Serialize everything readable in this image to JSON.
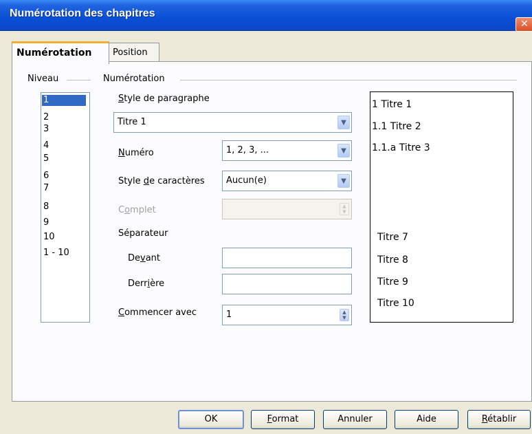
{
  "window": {
    "title": "Numérotation des chapitres",
    "close_glyph": "✕"
  },
  "tabs": [
    {
      "label": "Numérotation",
      "active": true
    },
    {
      "label": "Position",
      "active": false
    }
  ],
  "levels": {
    "label": "Niveau",
    "items": [
      "1",
      "2",
      "3",
      "4",
      "5",
      "6",
      "7",
      "8",
      "9",
      "10",
      "1 - 10"
    ],
    "selected": "1"
  },
  "numbering": {
    "group_label": "Numérotation",
    "paragraph_style": {
      "label_pre": "",
      "label_u": "S",
      "label_post": "tyle de paragraphe",
      "value": "Titre 1"
    },
    "number": {
      "label_pre": "",
      "label_u": "N",
      "label_post": "uméro",
      "value": "1, 2, 3, ..."
    },
    "char_style": {
      "label_pre": "Style ",
      "label_u": "d",
      "label_post": "e caractères",
      "value": "Aucun(e)"
    },
    "complete": {
      "label_pre": "C",
      "label_u": "o",
      "label_post": "mplet",
      "value": ""
    },
    "separator_label": "Séparateur",
    "before": {
      "label_pre": "De",
      "label_u": "v",
      "label_post": "ant",
      "value": ""
    },
    "after": {
      "label_pre": "Derr",
      "label_u": "i",
      "label_post": "ère",
      "value": ""
    },
    "start_with": {
      "label_pre": "",
      "label_u": "C",
      "label_post": "ommencer avec",
      "value": "1"
    }
  },
  "preview": [
    "1  Titre 1",
    "1.1  Titre 2",
    "1.1.a  Titre 3",
    "Titre 7",
    "Titre 8",
    "Titre 9",
    "Titre 10"
  ],
  "buttons": {
    "ok": {
      "pre": "OK",
      "u": "",
      "post": ""
    },
    "format": {
      "pre": "",
      "u": "F",
      "post": "ormat"
    },
    "cancel": {
      "pre": "Annuler",
      "u": "",
      "post": ""
    },
    "help": {
      "pre": "Aide",
      "u": "",
      "post": ""
    },
    "reset": {
      "pre": "",
      "u": "R",
      "post": "établir"
    }
  },
  "colors": {
    "titlebar": "#0a4fd6",
    "selection": "#316ac5",
    "dialog_bg": "#ece9d8"
  }
}
